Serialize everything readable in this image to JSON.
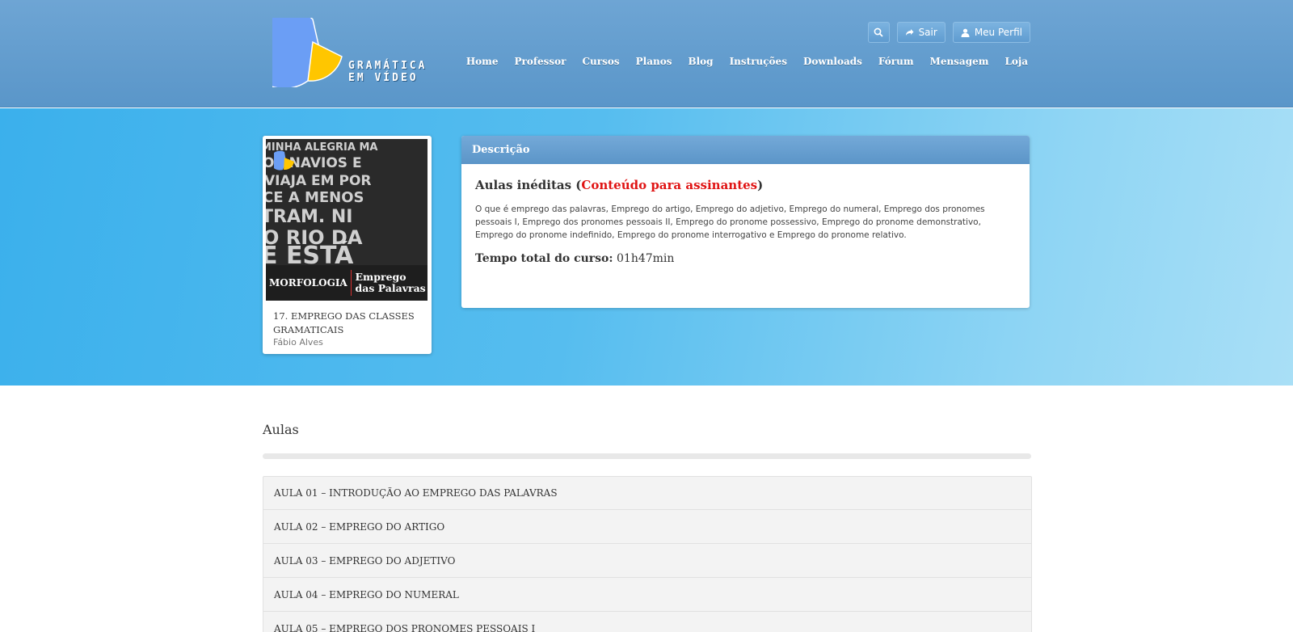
{
  "header": {
    "logo_alt": "Gramática em Vídeo",
    "logo_text_line1": "GRAMÁTICA",
    "logo_text_line2": "EM VÍDEO",
    "actions": {
      "search_icon": "search-icon",
      "logout_label": "Sair",
      "logout_icon": "share-arrow-icon",
      "profile_label": "Meu Perfil",
      "profile_icon": "user-icon"
    },
    "nav": [
      "Home",
      "Professor",
      "Cursos",
      "Planos",
      "Blog",
      "Instruções",
      "Downloads",
      "Fórum",
      "Mensagem",
      "Loja"
    ]
  },
  "course": {
    "thumb_label_left": "MORFOLOGIA",
    "thumb_label_right": "Emprego das Palavras",
    "title": "17. EMPREGO DAS CLASSES GRAMATICAIS",
    "author": "Fábio Alves"
  },
  "description": {
    "header": "Descrição",
    "heading_prefix": "Aulas inéditas (",
    "heading_highlight": "Conteúdo para assinantes",
    "heading_suffix": ")",
    "text": "O que é emprego das palavras, Emprego do artigo, Emprego do adjetivo, Emprego do numeral, Emprego dos pronomes pessoais I, Emprego dos pronomes pessoais II, Emprego do pronome possessivo, Emprego do pronome demonstrativo, Emprego do pronome indefinido, Emprego do pronome interrogativo e Emprego do pronome relativo.",
    "total_label": "Tempo total do curso:",
    "total_value": "01h47min"
  },
  "lessons": {
    "title": "Aulas",
    "items": [
      "AULA 01 – INTRODUÇÃO AO EMPREGO DAS PALAVRAS",
      "AULA 02 – EMPREGO DO ARTIGO",
      "AULA 03 – EMPREGO DO ADJETIVO",
      "AULA 04 – EMPREGO DO NUMERAL",
      "AULA 05 – EMPREGO DOS PRONOMES PESSOAIS I"
    ]
  },
  "colors": {
    "header_blue": "#5f9bcd",
    "hero_blue": "#47b5ed",
    "highlight_red": "#e01414",
    "logo_yellow": "#ffc600",
    "logo_blue": "#6b9ef5"
  }
}
